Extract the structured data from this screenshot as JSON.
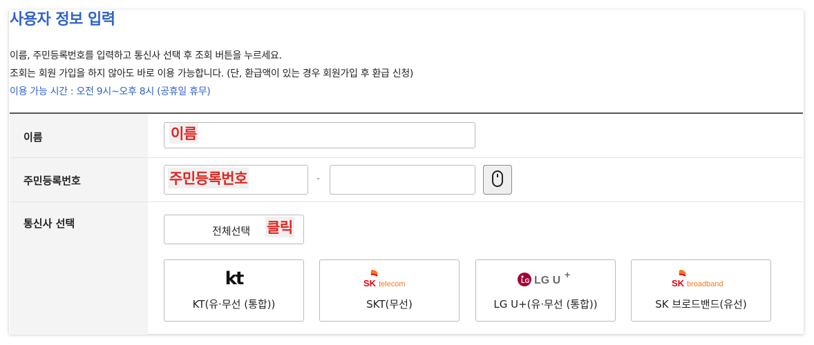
{
  "page": {
    "title": "사용자 정보 입력",
    "desc_line1": "이름, 주민등록번호를 입력하고 통신사 선택 후 조회 버튼을 누르세요.",
    "desc_line2": "조회는 회원 가입을 하지 않아도 바로 이용 가능합니다. (단, 환급액이 있는 경우 회원가입 후 환급 신청)",
    "desc_hours": "이용 가능 시간 : 오전 9시~오후 8시 (공휴일 휴무)"
  },
  "form": {
    "name_label": "이름",
    "name_annotation": "이름",
    "rrn_label": "주민등록번호",
    "rrn_annotation": "주민등록번호",
    "rrn_separator": "-",
    "carrier_label": "통신사 선택",
    "select_all_label": "전체선택",
    "select_all_annotation": "클릭"
  },
  "carriers": [
    {
      "logo_text": "kt",
      "label": "KT(유·무선 (통합))",
      "icon": "kt-logo"
    },
    {
      "logo_text": "SK telecom",
      "label": "SKT(무선)",
      "icon": "skt-logo"
    },
    {
      "logo_text": "LG U+",
      "label": "LG U+(유·무선 (통합))",
      "icon": "lguplus-logo"
    },
    {
      "logo_text": "SK broadband",
      "label": "SK 브로드밴드(유선)",
      "icon": "skbroadband-logo"
    }
  ],
  "colors": {
    "title_blue": "#2f62c8",
    "annotation_red": "#e0251f",
    "kt_red": "#e60012",
    "sk_orange": "#f47920",
    "lg_magenta": "#a50034"
  }
}
